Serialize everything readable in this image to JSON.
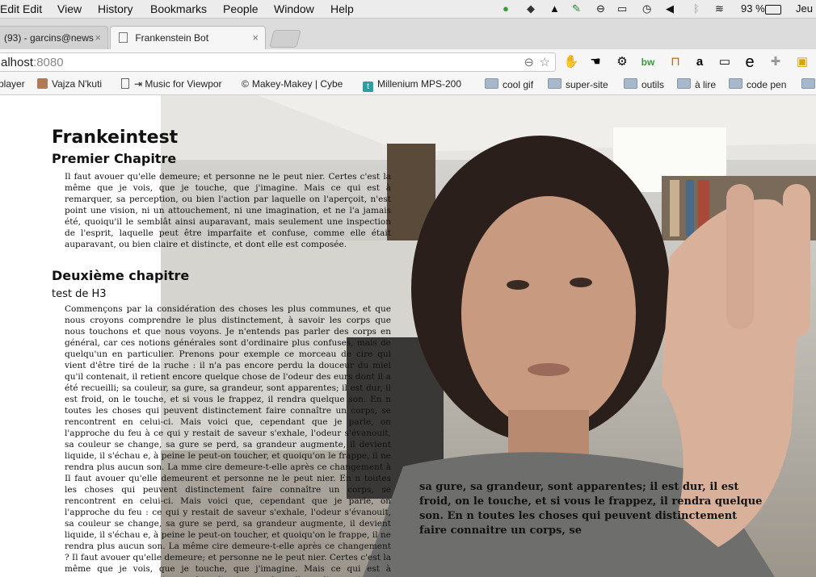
{
  "menubar": {
    "items": [
      "Edit",
      "View",
      "History",
      "Bookmarks",
      "People",
      "Window",
      "Help"
    ],
    "battery": "93 %",
    "clock": "Jeu"
  },
  "tabs": [
    {
      "label": "(93) - garcins@news",
      "close": "×"
    },
    {
      "label": "Frankenstein Bot",
      "close": "×"
    }
  ],
  "toolbar": {
    "url_host": "alhost",
    "url_port": ":8080"
  },
  "bookmarks": [
    {
      "label": "player",
      "kind": "plain"
    },
    {
      "label": "Vajza N'kuti",
      "kind": "avatar"
    },
    {
      "label": "Music for Viewpor",
      "kind": "page"
    },
    {
      "label": "Makey-Makey | Cybe",
      "kind": "copyright"
    },
    {
      "label": "Millenium MPS-200",
      "kind": "teal"
    },
    {
      "label": "cool gif",
      "kind": "folder"
    },
    {
      "label": "super-site",
      "kind": "folder"
    },
    {
      "label": "outils",
      "kind": "folder"
    },
    {
      "label": "à lire",
      "kind": "folder"
    },
    {
      "label": "code pen",
      "kind": "folder"
    }
  ],
  "document": {
    "title": "Frankeintest",
    "chapter1": "Premier Chapitre",
    "para1": "Il faut avouer qu'elle demeure; et personne ne le peut nier. Certes c'est la même que je vois, que je touche, que j'imagine. Mais ce qui est à remarquer, sa perception, ou bien l'action par laquelle on l'aperçoit, n'est point une vision, ni un attouchement, ni une imagination, et ne l'a jamais été, quoiqu'il le semblât ainsi auparavant, mais seulement une inspection de l'esprit, laquelle peut être imparfaite et confuse, comme elle était auparavant, ou bien claire et distincte, et dont elle est composée.",
    "chapter2": "Deuxième chapitre",
    "h3": "test de H3",
    "para2": "Commençons par la considération des choses les plus communes, et que nous croyons comprendre le plus distinctement, à savoir les corps que nous touchons et que nous voyons. Je n'entends pas parler des corps en général, car ces notions générales sont d'ordinaire plus confuses, mais de quelqu'un en particulier. Prenons pour exemple ce morceau de cire qui vient d'être tiré de la ruche : il n'a pas encore perdu la douceur du miel qu'il contenait, il retient encore quelque chose de l'odeur des eurs dont il a été recueilli; sa couleur, sa gure, sa grandeur, sont apparentes; il est dur, il est froid, on le touche, et si vous le frappez, il rendra quelque son. En n toutes les choses qui peuvent distinctement faire connaître un corps, se rencontrent en celui-ci. Mais voici que, cependant que je parle, on l'approche du feu à ce qui y restait de saveur s'exhale, l'odeur s'évanouit, sa couleur se change, sa gure se perd, sa grandeur augmente, il devient liquide, il s'échau e, à peine le peut-on toucher, et quoiqu'on le frappe, il ne rendra plus aucun son. La mme cire demeure-t-elle après ce changement à Il faut avouer qu'elle demeurent et personne ne le peut nier. En n toutes les choses qui peuvent distinctement faire connaître un corps, se rencontrent en celui-ci. Mais voici que, cependant que je parle, on l'approche du feu : ce qui y restait de saveur s'exhale, l'odeur s'évanouit, sa couleur se change, sa gure se perd, sa grandeur augmente, il devient liquide, il s'échau e, à peine le peut-on toucher, et quoiqu'on le frappe, il ne rendra plus aucun son. La même cire demeure-t-elle après ce changement ? Il faut avouer qu'elle demeure; et personne ne le peut nier. Certes c'est la même que je vois, que je touche, que j'imagine. Mais ce qui est à remarquer, sa perception, ou bien l'action par laquelle on l'aperçoit, n'est point une vision, ni un"
  },
  "overlay": {
    "text": "sa gure, sa grandeur, sont apparentes; il est dur, il est froid, on le touche, et si vous le frappez, il rendra quelque son. En n toutes les choses qui peuvent distinctement faire connaitre un corps, se"
  }
}
